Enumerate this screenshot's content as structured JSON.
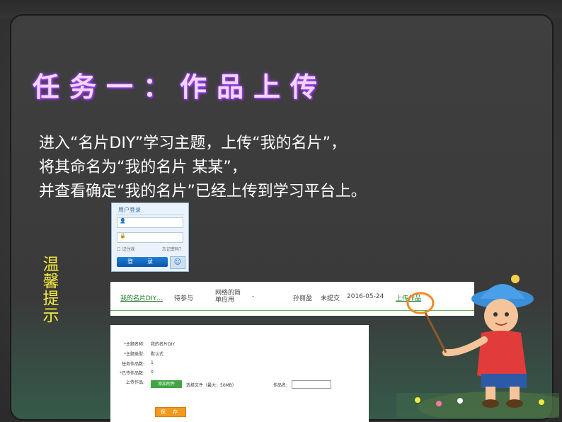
{
  "slide": {
    "title": "任务一：作品上传",
    "intro_lines": [
      "进入“名片DIY”学习主题，上传“我的名片”，",
      "将其命名为“我的名片 某某”，",
      "并查看确定“我的名片”已经上传到学习平台上。"
    ],
    "tip_chars": [
      "温",
      "馨",
      "提",
      "示"
    ]
  },
  "login": {
    "title": "用户登录",
    "remember": "记住我",
    "forgot": "忘记密码？",
    "button": "登　录"
  },
  "assignment_row": {
    "name": "我的名片DIY…",
    "status_join": "待参与",
    "category": "网络的简单应用",
    "dash": "-",
    "teacher": "孙丽盈",
    "submit_status": "未提交",
    "date": "2016-05-24",
    "action": "上传作品"
  },
  "upload_form": {
    "labels": {
      "theme_name": "主题名称:",
      "theme_type": "主题类型:",
      "task_count": "任务作品数:",
      "uploaded_count": "已传作品数:",
      "upload": "上传作品:"
    },
    "values": {
      "theme_name": "我的名片DIY",
      "theme_type": "默认式",
      "task_count": "1",
      "uploaded_count": "0"
    },
    "add_attachment": "添加附件",
    "choose_file": "选择文件（最大：50MB）",
    "work_name_label": "作品名:",
    "work_name_value": "",
    "save_button": "保 存"
  },
  "colors": {
    "title_glow": "#a040ff",
    "tip_yellow": "#f4ea3c",
    "link_green": "#1a7a2a",
    "login_button": "#0a56a8",
    "save_button": "#f39a1e"
  }
}
